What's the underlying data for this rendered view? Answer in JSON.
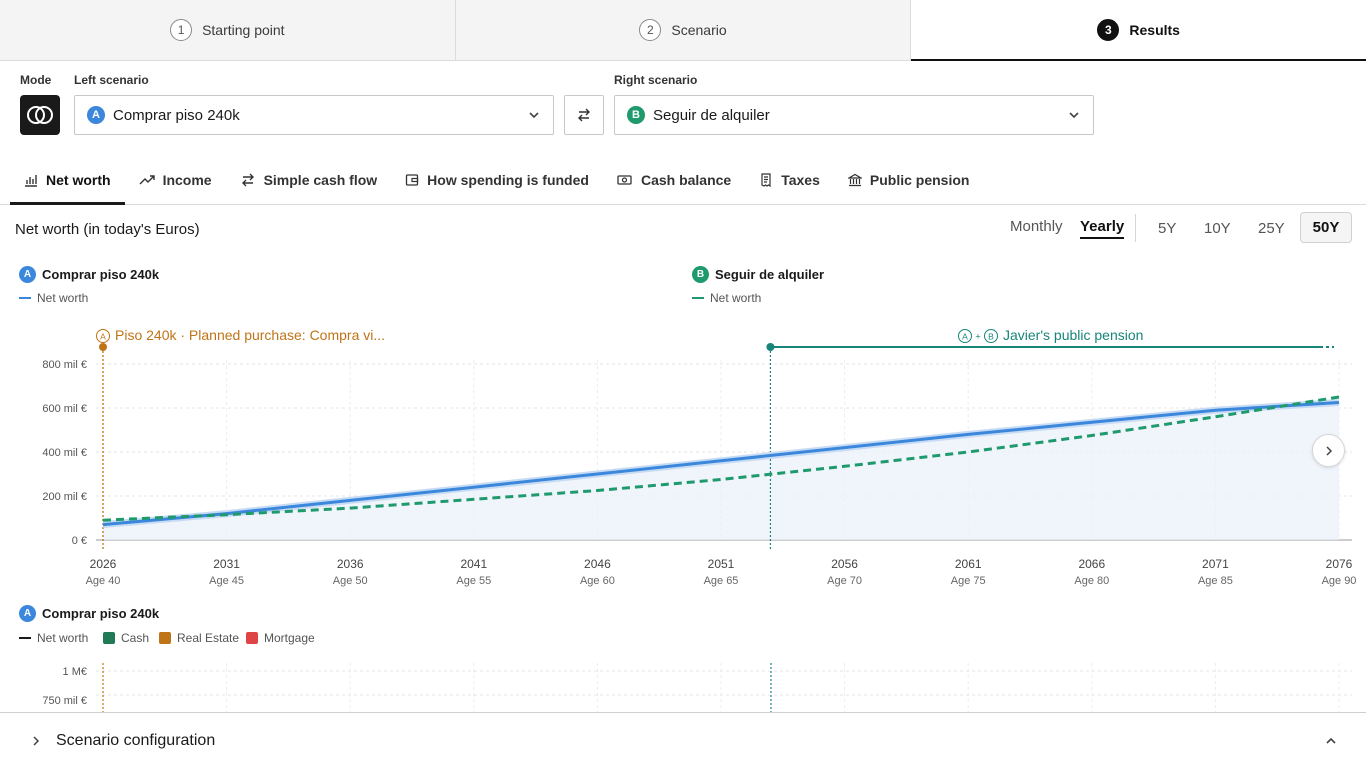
{
  "stepper": {
    "steps": [
      {
        "num": "1",
        "label": "Starting point"
      },
      {
        "num": "2",
        "label": "Scenario"
      },
      {
        "num": "3",
        "label": "Results"
      }
    ]
  },
  "selectors": {
    "mode_label": "Mode",
    "left_label": "Left scenario",
    "right_label": "Right scenario",
    "left_value": "Comprar piso 240k",
    "left_badge": "A",
    "right_value": "Seguir de alquiler",
    "right_badge": "B"
  },
  "tabs": [
    {
      "label": "Net worth",
      "icon": "bar-chart-icon"
    },
    {
      "label": "Income",
      "icon": "trend-up-icon"
    },
    {
      "label": "Simple cash flow",
      "icon": "swap-arrows-icon"
    },
    {
      "label": "How spending is funded",
      "icon": "wallet-icon"
    },
    {
      "label": "Cash balance",
      "icon": "banknote-icon"
    },
    {
      "label": "Taxes",
      "icon": "receipt-icon"
    },
    {
      "label": "Public pension",
      "icon": "bank-icon"
    }
  ],
  "chart_header": {
    "title": "Net worth (in today's Euros)",
    "monthly": "Monthly",
    "yearly": "Yearly",
    "ranges": [
      "5Y",
      "10Y",
      "25Y",
      "50Y"
    ]
  },
  "legend": {
    "a_name": "Comprar piso 240k",
    "a_series": "Net worth",
    "b_name": "Seguir de alquiler",
    "b_series": "Net worth"
  },
  "events": {
    "purchase_badge": "A",
    "purchase_label": "Piso 240k · Planned purchase: Compra vi...",
    "pension_badge_a": "A",
    "pension_plus": "+",
    "pension_badge_b": "B",
    "pension_label": "Javier's public pension"
  },
  "colors": {
    "a": "#3b87dc",
    "b": "#1e9a6c",
    "purchase": "#c07418",
    "pension": "#17857a",
    "cash": "#1f7a55",
    "real_estate": "#c07418",
    "mortgage": "#de4545"
  },
  "chart_data": {
    "type": "line",
    "y_tick_labels": [
      "0 €",
      "200 mil €",
      "400 mil €",
      "600 mil €",
      "800 mil €"
    ],
    "y_ticks": [
      0,
      200000,
      400000,
      600000,
      800000
    ],
    "ylim": [
      0,
      800000
    ],
    "x_ticks": [
      2026,
      2031,
      2036,
      2041,
      2046,
      2051,
      2056,
      2061,
      2066,
      2071,
      2076
    ],
    "x_tick_ages": [
      "Age 40",
      "Age 45",
      "Age 50",
      "Age 55",
      "Age 60",
      "Age 65",
      "Age 70",
      "Age 75",
      "Age 80",
      "Age 85",
      "Age 90"
    ],
    "xlim": [
      2026,
      2076
    ],
    "series": [
      {
        "name": "Net worth",
        "scenario": "A",
        "style": "solid",
        "x": [
          2026,
          2031,
          2036,
          2041,
          2046,
          2051,
          2056,
          2061,
          2066,
          2071,
          2076
        ],
        "values": [
          70000,
          120000,
          180000,
          240000,
          300000,
          360000,
          420000,
          480000,
          535000,
          590000,
          625000
        ]
      },
      {
        "name": "Net worth",
        "scenario": "B",
        "style": "dashed",
        "x": [
          2026,
          2031,
          2036,
          2041,
          2046,
          2051,
          2056,
          2061,
          2066,
          2071,
          2076
        ],
        "values": [
          90000,
          115000,
          145000,
          185000,
          225000,
          275000,
          335000,
          400000,
          475000,
          560000,
          650000
        ]
      }
    ],
    "events": [
      {
        "label": "Piso 240k · Planned purchase: Compra vi...",
        "x": 2026
      },
      {
        "label": "Javier's public pension",
        "x_start": 2053,
        "x_end": 2076
      }
    ],
    "grid": true
  },
  "lower_chart": {
    "scenario_badge": "A",
    "scenario_name": "Comprar piso 240k",
    "legend": [
      {
        "label": "Net worth",
        "kind": "line"
      },
      {
        "label": "Cash",
        "kind": "square"
      },
      {
        "label": "Real Estate",
        "kind": "square"
      },
      {
        "label": "Mortgage",
        "kind": "square"
      }
    ],
    "y_tick_labels": [
      "1 M€",
      "750 mil €"
    ]
  },
  "config": {
    "label": "Scenario configuration"
  }
}
